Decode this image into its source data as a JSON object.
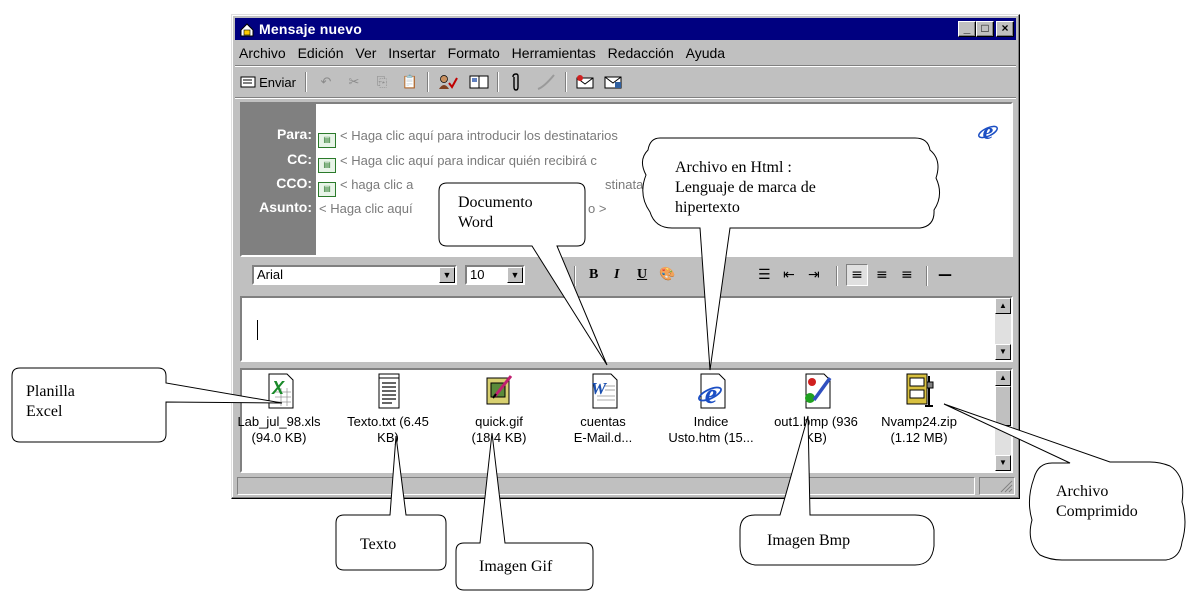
{
  "window": {
    "title": "Mensaje nuevo",
    "controls": [
      "_",
      "□",
      "×"
    ]
  },
  "menu": [
    {
      "label": "Archivo"
    },
    {
      "label": "Edición"
    },
    {
      "label": "Ver"
    },
    {
      "label": "Insertar"
    },
    {
      "label": "Formato"
    },
    {
      "label": "Herramientas"
    },
    {
      "label": "Redacción"
    },
    {
      "label": "Ayuda"
    }
  ],
  "toolbar": {
    "send_label": "Enviar"
  },
  "header": {
    "to_label": "Para:",
    "to_value": "< Haga clic aquí para introducir los destinatarios",
    "cc_label": "CC:",
    "cc_value": "< Haga clic aquí para indicar quién recibirá c",
    "bcc_label": "CCO:",
    "bcc_value": "< haga clic a",
    "bcc_value_tail": "stinatarios",
    "subject_label": "Asunto:",
    "subject_value": "< Haga clic aquí",
    "subject_value_tail": "o >"
  },
  "format": {
    "font": "Arial",
    "size": "10"
  },
  "attachments": [
    {
      "line1": "Lab_jul_98.xls",
      "line2": "(94.0 KB)",
      "icon": "excel-icon"
    },
    {
      "line1": "Texto.txt (6.45",
      "line2": "KB)",
      "icon": "text-file-icon"
    },
    {
      "line1": "quick.gif",
      "line2": "(18.4 KB)",
      "icon": "gif-image-icon"
    },
    {
      "line1": "cuentas",
      "line2": "E-Mail.d...",
      "icon": "word-doc-icon"
    },
    {
      "line1": "Indice",
      "line2": "Usto.htm (15...",
      "icon": "html-ie-icon"
    },
    {
      "line1": "out1.bmp (936",
      "line2": "KB)",
      "icon": "bmp-paint-icon"
    },
    {
      "line1": "Nvamp24.zip",
      "line2": "(1.12 MB)",
      "icon": "zip-archive-icon"
    }
  ],
  "callouts": {
    "excel": [
      "Planilla",
      "Excel"
    ],
    "word": [
      "Documento",
      "Word"
    ],
    "html": [
      "Archivo en Html :",
      "Lenguaje de marca de",
      "hipertexto"
    ],
    "zip": [
      "Archivo",
      "Comprimido"
    ],
    "text": "Texto",
    "gif": "Imagen Gif",
    "bmp": "Imagen Bmp"
  }
}
